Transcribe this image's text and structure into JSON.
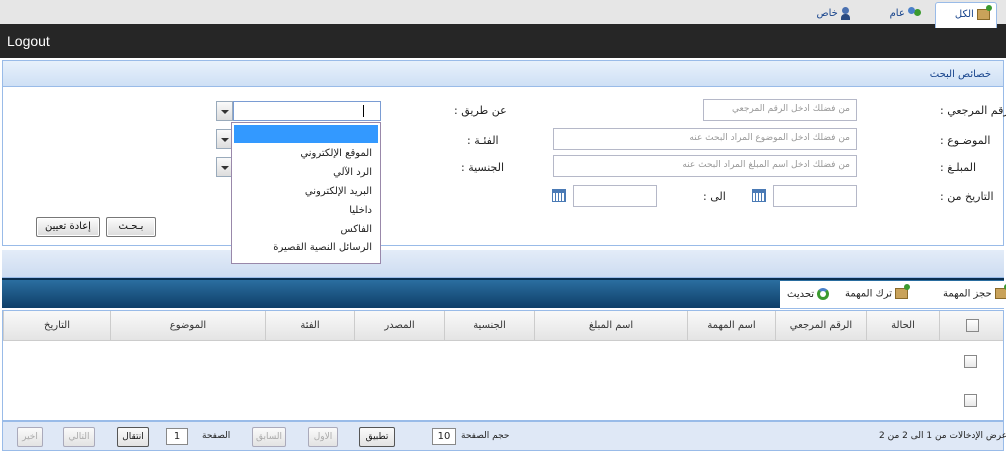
{
  "header": {
    "logout_label": "Logout"
  },
  "search_panel": {
    "title": "خصائص البحث",
    "reference_label": "الرقم المرجعي :",
    "reference_placeholder": "من فضلك ادخل الرقم المرجعي",
    "subject_label": "الموضـوع :",
    "subject_placeholder": "من فضلك ادخل الموضوع المراد البحث عنه",
    "amount_label": "المبلـغ :",
    "amount_placeholder": "من فضلك ادخل اسم المبلغ المراد البحث عنه",
    "date_from_label": "التاريخ من :",
    "date_to_label": "الى :",
    "via_label": "عن طريق :",
    "category_label": "الفئـة :",
    "nationality_label": "الجنسية :",
    "search_button": "بـحـث",
    "reset_button": "إعادة تعيين"
  },
  "via_dropdown": {
    "options": [
      "",
      "الموقع الإلكتروني",
      "الرد الآلي",
      "البريد الإلكتروني",
      "داخليا",
      "الفاكس",
      "الرسائل النصية القصيرة"
    ]
  },
  "tabs": {
    "all": "الكل",
    "public": "عام",
    "private": "خاص"
  },
  "toolbar": {
    "reserve": "حجز المهمة",
    "release": "ترك المهمة",
    "refresh": "تحديث"
  },
  "grid": {
    "columns": [
      "الحالة",
      "الرقم المرجعي",
      "اسم المهمة",
      "اسم المبلغ",
      "الجنسية",
      "المصدر",
      "الفئة",
      "الموضوع",
      "التاريخ"
    ]
  },
  "pager": {
    "summary": "عرض الإدخالات من 1 الى 2 من 2",
    "page_size_label": "حجم الصفحة",
    "page_size_value": "10",
    "apply_button": "تطبيق",
    "first_button": "الاول",
    "prev_button": "السابق",
    "page_label": "الصفحة",
    "page_value": "1",
    "go_button": "انتقال",
    "next_button": "التالي",
    "last_button": "اخير"
  }
}
